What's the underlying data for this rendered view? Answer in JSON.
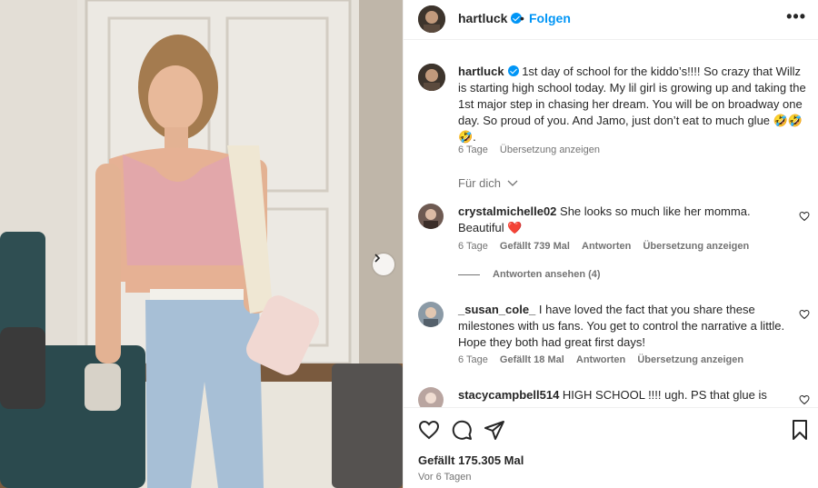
{
  "post": {
    "author": "hartluck",
    "follow_label": "Folgen",
    "header_separator": "•",
    "more_label": "•••"
  },
  "caption": {
    "author": "hartluck",
    "text": "1st day of school for the kiddo’s!!!! So crazy that Willz is starting high school today. My lil girl is growing up and taking the 1st major step in chasing her dream. You will be on broadway one day. So proud of you. And Jamo, just don’t eat to much glue 🤣🤣🤣.",
    "time": "6 Tage",
    "translate": "Übersetzung anzeigen"
  },
  "for_you_label": "Für dich",
  "comments": [
    {
      "user": "crystalmichelle02",
      "text": "She looks so much like her momma. Beautiful ❤️",
      "time": "6 Tage",
      "likes": "Gefällt 739 Mal",
      "reply": "Antworten",
      "translate": "Übersetzung anzeigen",
      "avatar_color": "#6e5a52"
    },
    {
      "user": "_susan_cole_",
      "text": "I have loved the fact that you share these milestones with us fans. You get to control the narrative a little. Hope they both had great first days!",
      "time": "6 Tage",
      "likes": "Gefällt 18 Mal",
      "reply": "Antworten",
      "translate": "Übersetzung anzeigen",
      "avatar_color": "#8b9aa6"
    },
    {
      "user": "stacycampbell514",
      "text": "HIGH SCHOOL !!!! ugh. PS that glue is",
      "avatar_color": "#b9a5a0"
    }
  ],
  "view_replies": "Antworten ansehen (4)",
  "footer": {
    "likes": "Gefällt 175.305 Mal",
    "ago": "Vor 6 Tagen"
  },
  "colors": {
    "accent": "#0095f6",
    "muted": "#737373",
    "text": "#262626"
  }
}
